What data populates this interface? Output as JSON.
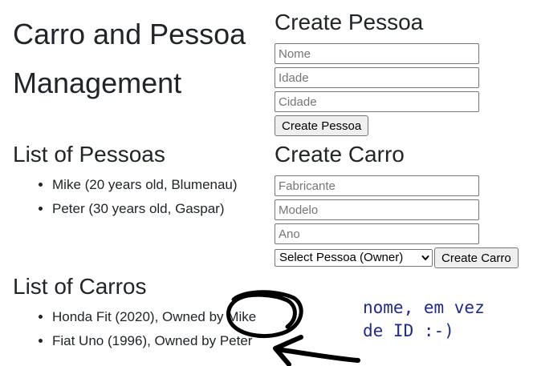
{
  "page": {
    "title": "Carro and Pessoa Management"
  },
  "pessoas": {
    "heading": "List of Pessoas",
    "items": [
      "Mike (20 years old, Blumenau)",
      "Peter (30 years old, Gaspar)"
    ]
  },
  "carros": {
    "heading": "List of Carros",
    "items": [
      "Honda Fit (2020), Owned by Mike",
      "Fiat Uno (1996), Owned by Peter"
    ]
  },
  "create_pessoa": {
    "heading": "Create Pessoa",
    "nome_placeholder": "Nome",
    "idade_placeholder": "Idade",
    "cidade_placeholder": "Cidade",
    "submit_label": "Create Pessoa"
  },
  "create_carro": {
    "heading": "Create Carro",
    "fabricante_placeholder": "Fabricante",
    "modelo_placeholder": "Modelo",
    "ano_placeholder": "Ano",
    "owner_select_value": "Select Pessoa (Owner)",
    "submit_label": "Create Carro"
  },
  "annotation": {
    "note": "nome, em vez\nde ID :-)",
    "ink_color": "#000000",
    "note_color": "#1f2a8a",
    "icons": [
      "circle-scribble",
      "arrow-left"
    ]
  }
}
